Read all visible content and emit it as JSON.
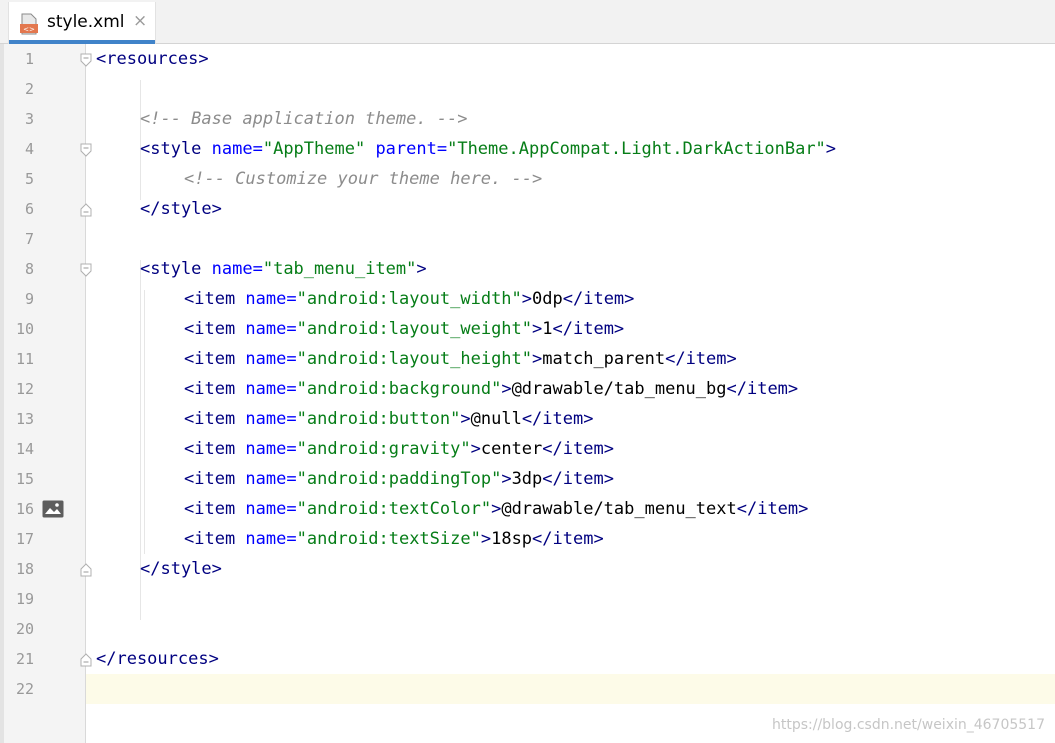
{
  "tab": {
    "title": "style.xml",
    "close_glyph": "×"
  },
  "watermark": "https://blog.csdn.net/weixin_46705517",
  "colors": {
    "accent": "#4083c9",
    "tag": "#000080",
    "attribute": "#0000ff",
    "value": "#067d17",
    "comment": "#8c8c8c"
  },
  "gutter": {
    "line_numbers": [
      "1",
      "2",
      "3",
      "4",
      "5",
      "6",
      "7",
      "8",
      "9",
      "10",
      "11",
      "12",
      "13",
      "14",
      "15",
      "16",
      "17",
      "18",
      "19",
      "20",
      "21",
      "22"
    ],
    "image_preview_icon": "image-icon"
  },
  "code": {
    "l1_open": "<resources>",
    "l3_comment": "<!-- Base application theme. -->",
    "l4_open": "<style",
    "l4_attr1": " name=",
    "l4_val1": "\"AppTheme\"",
    "l4_attr2": " parent=",
    "l4_val2": "\"Theme.AppCompat.Light.DarkActionBar\"",
    "l4_close": ">",
    "l5_comment": "<!-- Customize your theme here. -->",
    "l6_close": "</style>",
    "l8_open": "<style",
    "l8_attr": " name=",
    "l8_val": "\"tab_menu_item\"",
    "l8_close": ">",
    "item_open": "<item",
    "item_attr": " name=",
    "item_gt": ">",
    "item_close": "</item>",
    "items": [
      {
        "name": "\"android:layout_width\"",
        "value": "0dp"
      },
      {
        "name": "\"android:layout_weight\"",
        "value": "1"
      },
      {
        "name": "\"android:layout_height\"",
        "value": "match_parent"
      },
      {
        "name": "\"android:background\"",
        "value": "@drawable/tab_menu_bg"
      },
      {
        "name": "\"android:button\"",
        "value": "@null"
      },
      {
        "name": "\"android:gravity\"",
        "value": "center"
      },
      {
        "name": "\"android:paddingTop\"",
        "value": "3dp"
      },
      {
        "name": "\"android:textColor\"",
        "value": "@drawable/tab_menu_text"
      },
      {
        "name": "\"android:textSize\"",
        "value": "18sp"
      }
    ],
    "l18_close": "</style>",
    "l21_close": "</resources>"
  }
}
